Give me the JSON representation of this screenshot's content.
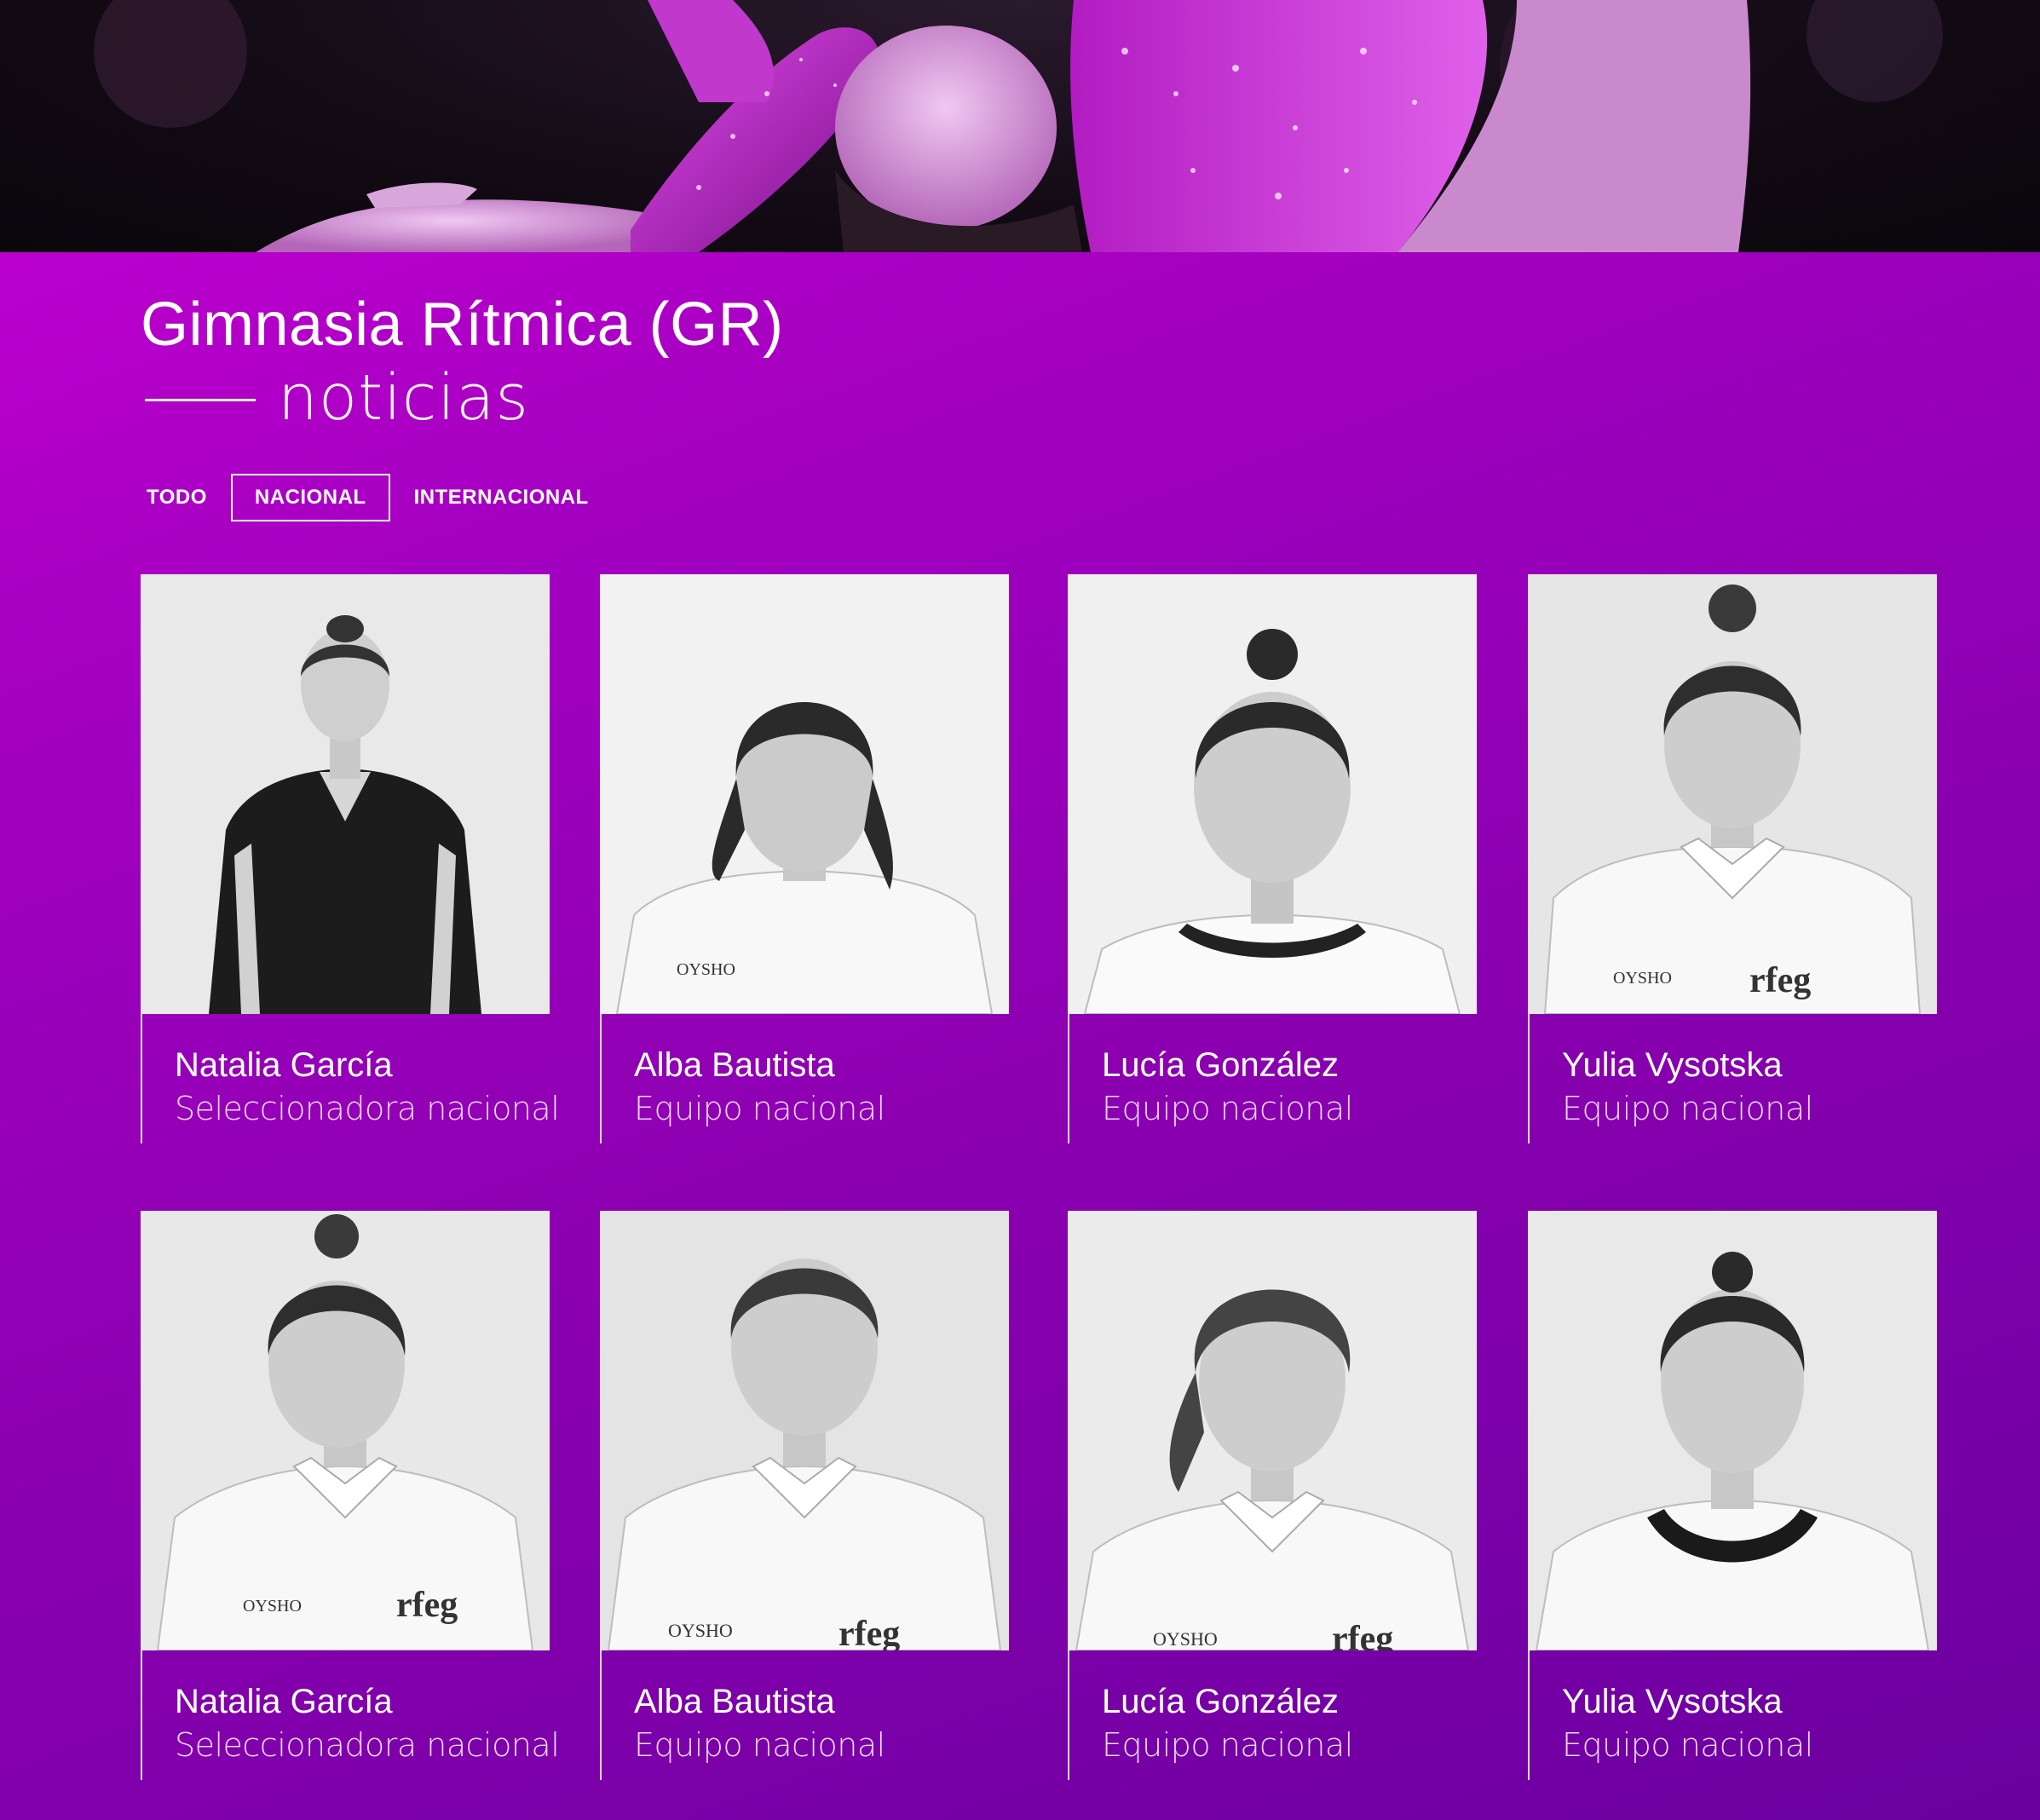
{
  "header": {
    "title": "Gimnasia Rítmica (GR)",
    "subtitle": "noticias"
  },
  "filters": {
    "items": [
      {
        "label": "TODO",
        "active": false
      },
      {
        "label": "NACIONAL",
        "active": true
      },
      {
        "label": "INTERNACIONAL",
        "active": false
      }
    ]
  },
  "cards": [
    {
      "name": "Natalia García",
      "role": "Seleccionadora nacional"
    },
    {
      "name": "Alba Bautista",
      "role": "Equipo nacional"
    },
    {
      "name": "Lucía González",
      "role": "Equipo nacional"
    },
    {
      "name": "Yulia Vysotska",
      "role": "Equipo nacional"
    },
    {
      "name": "Natalia García",
      "role": "Seleccionadora nacional"
    },
    {
      "name": "Alba Bautista",
      "role": "Equipo nacional"
    },
    {
      "name": "Lucía González",
      "role": "Equipo nacional"
    },
    {
      "name": "Yulia Vysotska",
      "role": "Equipo nacional"
    }
  ],
  "colors": {
    "accent": "#b000c8",
    "gradient_start": "#c800d4",
    "gradient_end": "#6a00a0",
    "text": "#ffffff"
  }
}
